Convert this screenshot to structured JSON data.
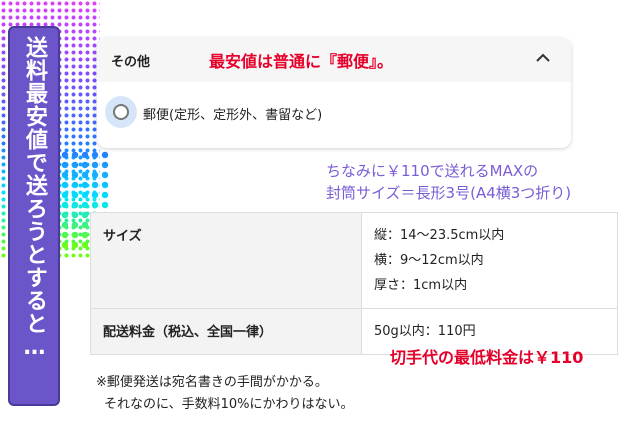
{
  "banner": {
    "text": "送料最安値で送ろうとすると…"
  },
  "card": {
    "title": "その他",
    "annotation": "最安値は普通に『郵便』。",
    "option_label": "郵便(定形、定形外、書留など)",
    "chevron_icon": "chevron-up-icon"
  },
  "note": {
    "line1": "ちなみに￥110で送れるMAXの",
    "line2": "封筒サイズ＝長形3号(A4横3つ折り)"
  },
  "table": {
    "rows": [
      {
        "header": "サイズ",
        "values": [
          "縦：14〜23.5cm以内",
          "横：9〜12cm以内",
          "厚さ：1cm以内"
        ]
      },
      {
        "header": "配送料金（税込、全国一律）",
        "values": [
          "50g以内：110円"
        ]
      }
    ]
  },
  "stamp_note": "切手代の最低料金は￥110",
  "footer": {
    "line1": "※郵便発送は宛名書きの手間がかかる。",
    "line2": "それなのに、手数料10%にかわりはない。"
  },
  "colors": {
    "accent_red": "#e5002b",
    "purple": "#7b5cd6",
    "banner": "#6c55c8"
  }
}
